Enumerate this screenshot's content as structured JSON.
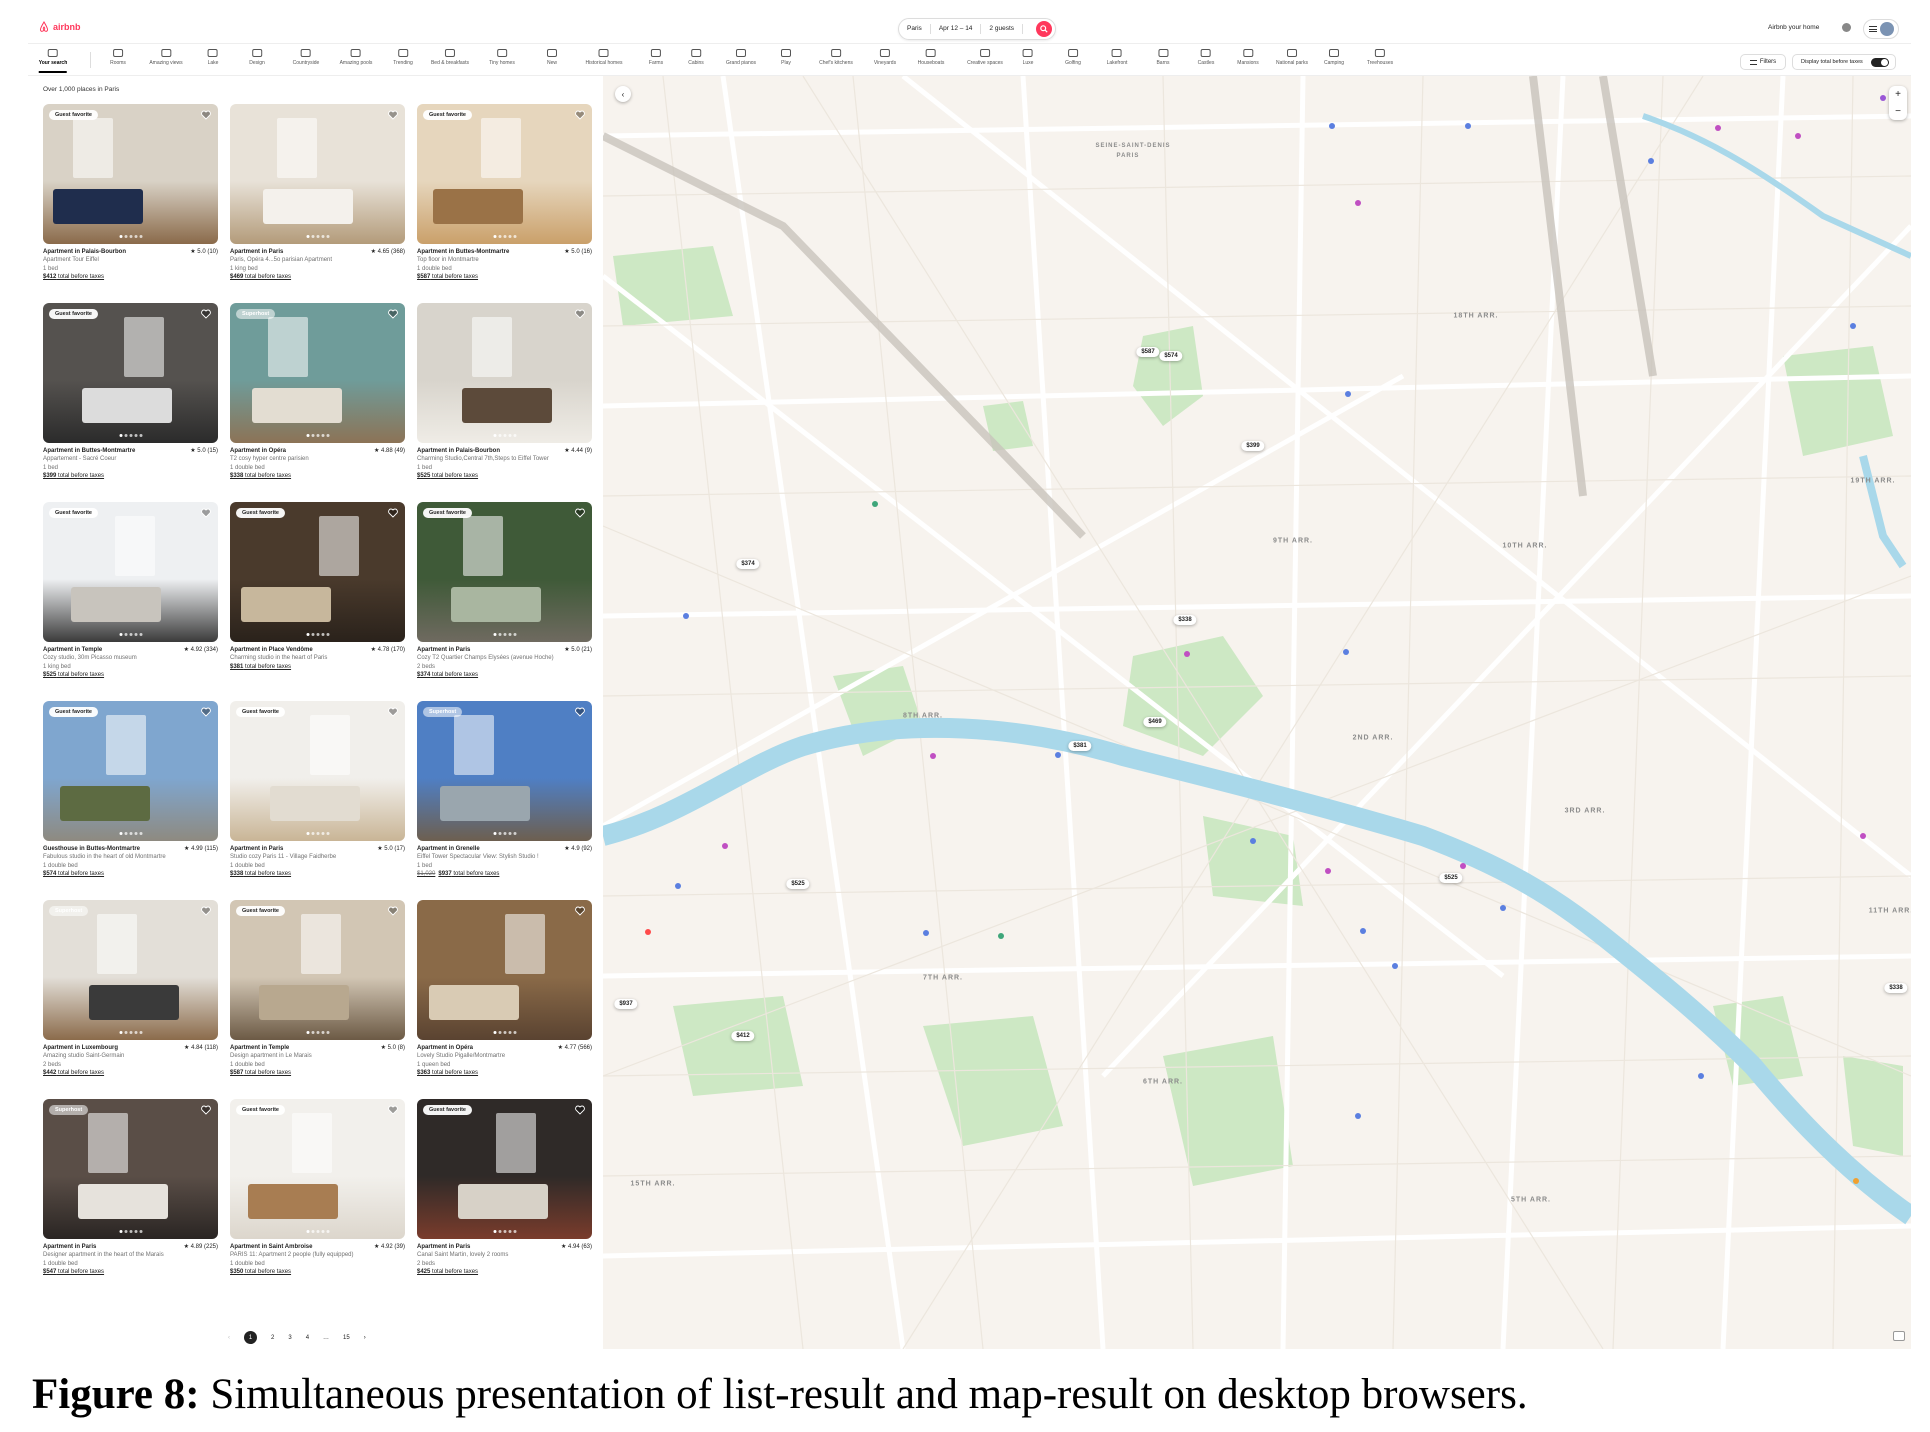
{
  "header": {
    "logo_text": "airbnb",
    "search": {
      "location": "Paris",
      "dates": "Apr 12 – 14",
      "guests": "2 guests"
    },
    "host_link": "Airbnb your home"
  },
  "categories": [
    {
      "label": "Your search",
      "active": true
    },
    {
      "label": "Rooms"
    },
    {
      "label": "Amazing views"
    },
    {
      "label": "Lake"
    },
    {
      "label": "Design"
    },
    {
      "label": "Countryside"
    },
    {
      "label": "Amazing pools"
    },
    {
      "label": "Trending"
    },
    {
      "label": "Bed & breakfasts"
    },
    {
      "label": "Tiny homes"
    },
    {
      "label": "New"
    },
    {
      "label": "Historical homes"
    },
    {
      "label": "Farms"
    },
    {
      "label": "Cabins"
    },
    {
      "label": "Grand pianos"
    },
    {
      "label": "Play"
    },
    {
      "label": "Chef's kitchens"
    },
    {
      "label": "Vineyards"
    },
    {
      "label": "Houseboats"
    },
    {
      "label": "Creative spaces"
    },
    {
      "label": "Luxe"
    },
    {
      "label": "Golfing"
    },
    {
      "label": "Lakefront"
    },
    {
      "label": "Barns"
    },
    {
      "label": "Castles"
    },
    {
      "label": "Mansions"
    },
    {
      "label": "National parks"
    },
    {
      "label": "Camping"
    },
    {
      "label": "Treehouses"
    }
  ],
  "toolbar": {
    "filters_label": "Filters",
    "toggle_label": "Display total before taxes",
    "toggle_on": true
  },
  "results_count": "Over 1,000 places in Paris",
  "listings": [
    {
      "badge": "Guest favorite",
      "title": "Apartment in Palais-Bourbon",
      "rating": "★ 5.0 (10)",
      "subtitle": "Apartment Tour Eiffel",
      "beds": "1 bed",
      "price": "$412",
      "price_suffix": " total before taxes",
      "colors": [
        "#d9d2c6",
        "#1f2d4d",
        "#8a6a4a"
      ]
    },
    {
      "badge": "",
      "title": "Apartment in Paris",
      "rating": "★ 4.65 (368)",
      "subtitle": "Paris, Opéra 4...5o parisian Apartment",
      "beds": "1 king bed",
      "price": "$469",
      "price_suffix": " total before taxes",
      "colors": [
        "#e8e2d8",
        "#f4f1ec",
        "#b39b7a"
      ]
    },
    {
      "badge": "Guest favorite",
      "title": "Apartment in Buttes-Montmartre",
      "rating": "★ 5.0 (16)",
      "subtitle": "Top floor in Montmartre",
      "beds": "1 double bed",
      "price": "$587",
      "price_suffix": " total before taxes",
      "colors": [
        "#e6d6bd",
        "#9a7247",
        "#caa06a"
      ]
    },
    {
      "badge": "Guest favorite",
      "title": "Apartment in Buttes-Montmartre",
      "rating": "★ 5.0 (15)",
      "subtitle": "Appartement - Sacré Coeur",
      "beds": "1 bed",
      "price": "$399",
      "price_suffix": " total before taxes",
      "colors": [
        "#55524f",
        "#dcdcdc",
        "#2b2b2b"
      ]
    },
    {
      "badge": "Superhost",
      "title": "Apartment in Opéra",
      "rating": "★ 4.88 (49)",
      "subtitle": "T2 cosy hyper centre parisien",
      "beds": "1 double bed",
      "price": "$338",
      "price_suffix": " total before taxes",
      "colors": [
        "#6f9c9a",
        "#e3ddd2",
        "#8c7356"
      ]
    },
    {
      "badge": "",
      "title": "Apartment in Palais-Bourbon",
      "rating": "★ 4.44 (9)",
      "subtitle": "Charming Studio,Central 7th,Steps to Eiffel Tower",
      "beds": "1 bed",
      "price": "$525",
      "price_suffix": " total before taxes",
      "colors": [
        "#d8d4cc",
        "#5c4a3a",
        "#efece6"
      ]
    },
    {
      "badge": "Guest favorite",
      "title": "Apartment in Temple",
      "rating": "★ 4.92 (334)",
      "subtitle": "Cozy studio, 30m Picasso museum",
      "beds": "1 king bed",
      "price": "$525",
      "price_suffix": " total before taxes",
      "colors": [
        "#eef0f2",
        "#c8c4bd",
        "#3b3b3b"
      ]
    },
    {
      "badge": "Guest favorite",
      "title": "Apartment in Place Vendôme",
      "rating": "★ 4.78 (170)",
      "subtitle": "Charming studio in the heart of Paris",
      "beds": "",
      "price": "$381",
      "price_suffix": " total before taxes",
      "colors": [
        "#4a3a2c",
        "#c7b79c",
        "#2a221b"
      ]
    },
    {
      "badge": "Guest favorite",
      "title": "Apartment in Paris",
      "rating": "★ 5.0 (21)",
      "subtitle": "Cozy T2 Quartier Champs Elysées (avenue Hoche)",
      "beds": "2 beds",
      "price": "$374",
      "price_suffix": " total before taxes",
      "colors": [
        "#3f5a38",
        "#a9b6a0",
        "#6f6a60"
      ]
    },
    {
      "badge": "Guest favorite",
      "title": "Guesthouse in Buttes-Montmartre",
      "rating": "★ 4.99 (115)",
      "subtitle": "Fabulous studio in the heart of old Montmartre",
      "beds": "1 double bed",
      "price": "$574",
      "price_suffix": " total before taxes",
      "colors": [
        "#7fa6cf",
        "#5d6b42",
        "#8e8a80"
      ]
    },
    {
      "badge": "Guest favorite",
      "title": "Apartment in Paris",
      "rating": "★ 5.0 (17)",
      "subtitle": "Studio cozy Paris 11 - Village Faidherbe",
      "beds": "1 double bed",
      "price": "$338",
      "price_suffix": " total before taxes",
      "colors": [
        "#f1efeb",
        "#e2dcd1",
        "#c9b596"
      ]
    },
    {
      "badge": "Superhost",
      "title": "Apartment in Grenelle",
      "rating": "★ 4.9 (92)",
      "subtitle": "Eiffel Tower Spectacular View: Stylish Studio !",
      "beds": "1 bed",
      "price": "$937",
      "old_price": "$1,020",
      "price_suffix": " total before taxes",
      "colors": [
        "#4f7fc4",
        "#9aa6ae",
        "#6d5f4f"
      ]
    },
    {
      "badge": "Superhost",
      "title": "Apartment in Luxembourg",
      "rating": "★ 4.84 (118)",
      "subtitle": "Amazing studio Saint-Germain",
      "beds": "2 beds",
      "price": "$442",
      "price_suffix": " total before taxes",
      "colors": [
        "#e3dfd8",
        "#3a3a3a",
        "#8b6b4b"
      ]
    },
    {
      "badge": "Guest favorite",
      "title": "Apartment in Temple",
      "rating": "★ 5.0 (8)",
      "subtitle": "Design apartment in Le Marais",
      "beds": "1 double bed",
      "price": "$587",
      "price_suffix": " total before taxes",
      "colors": [
        "#d2c6b4",
        "#b8a88f",
        "#6c5a45"
      ]
    },
    {
      "badge": "",
      "title": "Apartment in Opéra",
      "rating": "★ 4.77 (566)",
      "subtitle": "Lovely Studio Pigalle/Montmartre",
      "beds": "1 queen bed",
      "price": "$363",
      "price_suffix": " total before taxes",
      "colors": [
        "#8a6a48",
        "#d9cbb4",
        "#5a4331"
      ]
    },
    {
      "badge": "Superhost",
      "title": "Apartment in Paris",
      "rating": "★ 4.89 (225)",
      "subtitle": "Designer apartment in the heart of the Marais",
      "beds": "1 double bed",
      "price": "$547",
      "price_suffix": " total before taxes",
      "colors": [
        "#5a4e47",
        "#e6e2dc",
        "#2a2523"
      ]
    },
    {
      "badge": "Guest favorite",
      "title": "Apartment in Saint Ambroise",
      "rating": "★ 4.92 (39)",
      "subtitle": "PARIS 11: Apartment 2 people (fully equipped)",
      "beds": "1 double bed",
      "price": "$350",
      "price_suffix": " total before taxes",
      "colors": [
        "#f2f0ec",
        "#a87d52",
        "#dcd6cc"
      ]
    },
    {
      "badge": "Guest favorite",
      "title": "Apartment in Paris",
      "rating": "★ 4.94 (63)",
      "subtitle": "Canal Saint Martin, lovely 2 rooms",
      "beds": "2 beds",
      "price": "$425",
      "price_suffix": " total before taxes",
      "colors": [
        "#2f2a28",
        "#d7d1c7",
        "#7a3c2c"
      ]
    }
  ],
  "pagination": {
    "prev": "‹",
    "pages": [
      "1",
      "2",
      "3",
      "4",
      "…",
      "15"
    ],
    "next": "›",
    "active": "1"
  },
  "map": {
    "price_pins": [
      {
        "label": "$587"
      },
      {
        "label": "$574"
      },
      {
        "label": "$399"
      },
      {
        "label": "$374"
      },
      {
        "label": "$338"
      },
      {
        "label": "$469"
      },
      {
        "label": "$381"
      },
      {
        "label": "$525"
      },
      {
        "label": "$525"
      },
      {
        "label": "$937"
      },
      {
        "label": "$412"
      },
      {
        "label": "$338"
      }
    ],
    "area_labels": [
      "18TH ARR.",
      "9TH ARR.",
      "10TH ARR.",
      "8TH ARR.",
      "2ND ARR.",
      "3RD ARR.",
      "19TH ARR.",
      "11TH ARR.",
      "7TH ARR.",
      "6TH ARR.",
      "15TH ARR.",
      "5TH ARR.",
      "SEINE-SAINT-DENIS",
      "PARIS"
    ],
    "zoom_in": "+",
    "zoom_out": "−",
    "collapse_glyph": "‹"
  },
  "caption": {
    "label": "Figure 8:",
    "text": " Simultaneous presentation of list-result and map-result on desktop browsers."
  },
  "colors": {
    "brand": "#ff385c",
    "water": "#a9d8ea",
    "park": "#cde8c4"
  }
}
